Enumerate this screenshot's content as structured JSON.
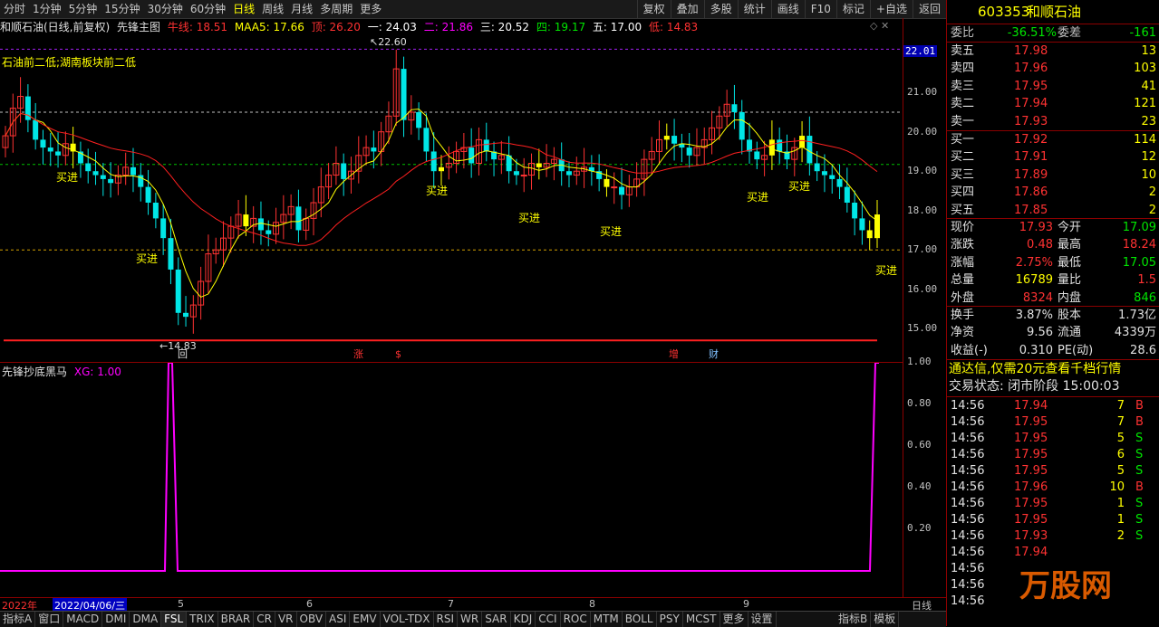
{
  "toolbar": {
    "periods": [
      "分时",
      "1分钟",
      "5分钟",
      "15分钟",
      "30分钟",
      "60分钟",
      "日线",
      "周线",
      "月线",
      "多周期",
      "更多"
    ],
    "active_period": "日线",
    "tools": [
      "复权",
      "叠加",
      "多股",
      "统计",
      "画线",
      "F10",
      "标记",
      "+自选",
      "返回"
    ]
  },
  "chart_header": {
    "stock_label": "和顺石油(日线,前复权)",
    "formula": "先锋主图",
    "niu": "牛线: 18.51",
    "maa5": "MAA5: 17.66",
    "ding": "顶: 26.20",
    "yi": "一: 24.03",
    "er": "二: 21.86",
    "san": "三: 20.52",
    "si": "四: 19.17",
    "wu": "五: 17.00",
    "di": "低: 14.83"
  },
  "annotations": {
    "note": "石油前二低;湖南板块前二低",
    "high": "22.60",
    "low": "14.83",
    "buy": "买进",
    "price_tag": "22.01",
    "markers": [
      "回",
      "涨",
      "$",
      "增",
      "财"
    ]
  },
  "main_axis": [
    "22.00",
    "21.00",
    "20.00",
    "19.00",
    "18.00",
    "17.00",
    "16.00",
    "15.00"
  ],
  "lower_panel": {
    "title": "先锋抄底黑马",
    "xg": "XG: 1.00",
    "axis": [
      "1.00",
      "0.80",
      "0.60",
      "0.40",
      "0.20"
    ]
  },
  "date_bar": {
    "year": "2022年",
    "cursor_date": "2022/04/06/三",
    "months": [
      "5",
      "6",
      "7",
      "8",
      "9"
    ],
    "right_label": "日线"
  },
  "bottom_tabs": [
    "指标A",
    "窗口",
    "MACD",
    "DMI",
    "DMA",
    "FSL",
    "TRIX",
    "BRAR",
    "CR",
    "VR",
    "OBV",
    "ASI",
    "EMV",
    "VOL-TDX",
    "RSI",
    "WR",
    "SAR",
    "KDJ",
    "CCI",
    "ROC",
    "MTM",
    "BOLL",
    "PSY",
    "MCST",
    "更多",
    "设置"
  ],
  "bottom_right_tabs": [
    "指标B",
    "模板"
  ],
  "quote": {
    "code": "603353",
    "name": "和顺石油",
    "weibi_label": "委比",
    "weibi": "-36.51%",
    "weicha_label": "委差",
    "weicha": "-161",
    "asks": [
      {
        "label": "卖五",
        "price": "17.98",
        "vol": "13"
      },
      {
        "label": "卖四",
        "price": "17.96",
        "vol": "103"
      },
      {
        "label": "卖三",
        "price": "17.95",
        "vol": "41"
      },
      {
        "label": "卖二",
        "price": "17.94",
        "vol": "121"
      },
      {
        "label": "卖一",
        "price": "17.93",
        "vol": "23"
      }
    ],
    "bids": [
      {
        "label": "买一",
        "price": "17.92",
        "vol": "114"
      },
      {
        "label": "买二",
        "price": "17.91",
        "vol": "12"
      },
      {
        "label": "买三",
        "price": "17.89",
        "vol": "10"
      },
      {
        "label": "买四",
        "price": "17.86",
        "vol": "2"
      },
      {
        "label": "买五",
        "price": "17.85",
        "vol": "2"
      }
    ],
    "stats": [
      {
        "l1": "现价",
        "v1": "17.93",
        "l2": "今开",
        "v2": "17.09",
        "c1": "red",
        "c2": "green"
      },
      {
        "l1": "涨跌",
        "v1": "0.48",
        "l2": "最高",
        "v2": "18.24",
        "c1": "red",
        "c2": "red"
      },
      {
        "l1": "涨幅",
        "v1": "2.75%",
        "l2": "最低",
        "v2": "17.05",
        "c1": "red",
        "c2": "green"
      },
      {
        "l1": "总量",
        "v1": "16789",
        "l2": "量比",
        "v2": "1.5",
        "c1": "yellow",
        "c2": "red"
      },
      {
        "l1": "外盘",
        "v1": "8324",
        "l2": "内盘",
        "v2": "846",
        "c1": "red",
        "c2": "green"
      }
    ],
    "stats2": [
      {
        "l1": "换手",
        "v1": "3.87%",
        "l2": "股本",
        "v2": "1.73亿"
      },
      {
        "l1": "净资",
        "v1": "9.56",
        "l2": "流通",
        "v2": "4339万"
      },
      {
        "l1": "收益(-)",
        "v1": "0.310",
        "l2": "PE(动)",
        "v2": "28.6"
      }
    ],
    "banner": "通达信,仅需20元查看千档行情",
    "trade_status": "交易状态: 闭市阶段 15:00:03",
    "ticks": [
      {
        "t": "14:56",
        "p": "17.94",
        "v": "7",
        "d": "B"
      },
      {
        "t": "14:56",
        "p": "17.95",
        "v": "7",
        "d": "B"
      },
      {
        "t": "14:56",
        "p": "17.95",
        "v": "5",
        "d": "S"
      },
      {
        "t": "14:56",
        "p": "17.95",
        "v": "6",
        "d": "S"
      },
      {
        "t": "14:56",
        "p": "17.95",
        "v": "5",
        "d": "S"
      },
      {
        "t": "14:56",
        "p": "17.96",
        "v": "10",
        "d": "B"
      },
      {
        "t": "14:56",
        "p": "17.95",
        "v": "1",
        "d": "S"
      },
      {
        "t": "14:56",
        "p": "17.95",
        "v": "1",
        "d": "S"
      },
      {
        "t": "14:56",
        "p": "17.93",
        "v": "2",
        "d": "S"
      },
      {
        "t": "14:56",
        "p": "17.94",
        "v": "",
        "d": ""
      },
      {
        "t": "14:56",
        "p": "",
        "v": "",
        "d": ""
      },
      {
        "t": "14:56",
        "p": "",
        "v": "",
        "d": ""
      },
      {
        "t": "14:56",
        "p": "",
        "v": "",
        "d": ""
      }
    ],
    "watermark": "万股网"
  },
  "colors": {
    "up": "#ff3232",
    "down": "#00e6e6",
    "buy_bar": "#ffff00",
    "signal": "#ff00ff",
    "ma_red": "#ff2020",
    "ma_yellow": "#ffff00"
  }
}
